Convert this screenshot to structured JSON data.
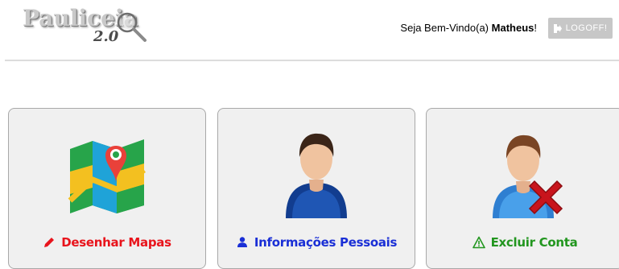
{
  "header": {
    "logo_text": "Pauliceia",
    "logo_version": "2.0",
    "welcome_prefix": "Seja Bem-Vindo(a) ",
    "user_name": "Matheus",
    "welcome_suffix": "!",
    "logoff_label": "LOGOFF!"
  },
  "cards": [
    {
      "label": "Desenhar Mapas",
      "icon": "pencil-icon",
      "image": "map-icon",
      "color": "#e8141c"
    },
    {
      "label": "Informações Pessoais",
      "icon": "user-icon",
      "image": "person-icon",
      "color": "#1a2fd6"
    },
    {
      "label": "Excluir Conta",
      "icon": "warning-icon",
      "image": "delete-user-icon",
      "color": "#22961f"
    }
  ],
  "colors": {
    "logoff_bg": "#c7c7c7",
    "card_bg": "#f0f0f0",
    "card_border": "#a8a8a8"
  }
}
